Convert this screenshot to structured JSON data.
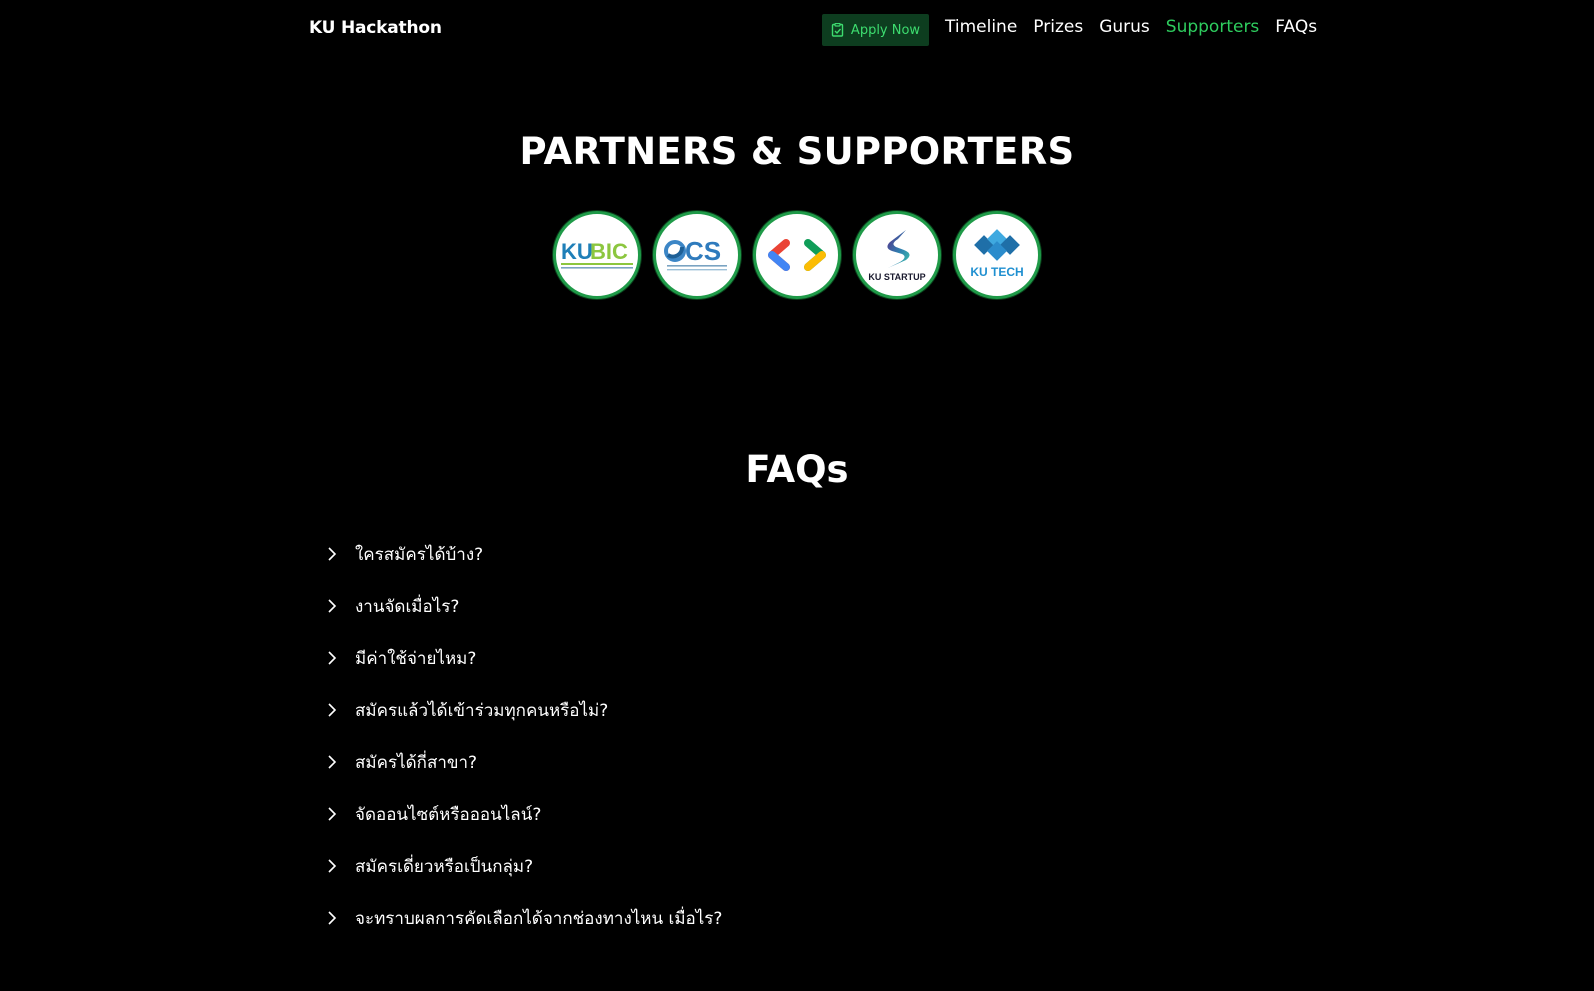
{
  "nav": {
    "brand": "KU Hackathon",
    "apply_label": "Apply Now",
    "links": [
      {
        "label": "Timeline",
        "active": false
      },
      {
        "label": "Prizes",
        "active": false
      },
      {
        "label": "Gurus",
        "active": false
      },
      {
        "label": "Supporters",
        "active": true
      },
      {
        "label": "FAQs",
        "active": false
      }
    ]
  },
  "partners": {
    "title": "PARTNERS & SUPPORTERS",
    "logos": [
      {
        "name": "kubic-logo",
        "text": "KUBIC"
      },
      {
        "name": "cs-logo",
        "text": "CS"
      },
      {
        "name": "gdsc-logo",
        "text": ""
      },
      {
        "name": "ku-startup-logo",
        "text": "KU STARTUP"
      },
      {
        "name": "ku-tech-logo",
        "text": "KU TECH"
      }
    ]
  },
  "faq": {
    "title": "FAQs",
    "items": [
      "ใครสมัครได้บ้าง?",
      "งานจัดเมื่อไร?",
      "มีค่าใช้จ่ายไหม?",
      "สมัครแล้วได้เข้าร่วมทุกคนหรือไม่?",
      "สมัครได้กี่สาขา?",
      "จัดออนไซต์หรือออนไลน์?",
      "สมัครเดี่ยวหรือเป็นกลุ่ม?",
      "จะทราบผลการคัดเลือกได้จากช่องทางไหน เมื่อไร?"
    ]
  },
  "colors": {
    "accent": "#2ecc5e",
    "apply_bg": "#0d3d1f",
    "background": "#000000"
  }
}
